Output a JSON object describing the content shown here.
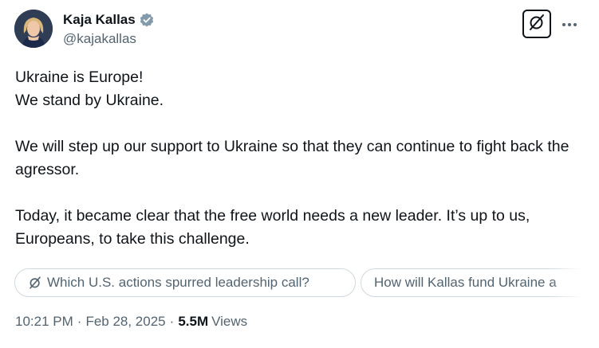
{
  "author": {
    "display_name": "Kaja Kallas",
    "handle": "@kajakallas",
    "verified": true
  },
  "tweet": {
    "lines": [
      "Ukraine is Europe!",
      "We stand by Ukraine.",
      "",
      "We will step up our support to Ukraine so that they can continue to fight back the agressor.",
      "",
      "Today, it became clear that the free world needs a new leader. It’s up to us, Europeans, to take this challenge."
    ]
  },
  "grok_suggestions": [
    {
      "label": "Which U.S. actions spurred leadership call?",
      "icon": "grok-icon"
    },
    {
      "label": "How will Kallas fund Ukraine a",
      "icon": "grok-icon"
    }
  ],
  "meta": {
    "time": "10:21 PM",
    "date": "Feb 28, 2025",
    "separator": "·",
    "views_count": "5.5M",
    "views_label": "Views"
  },
  "icons": {
    "verified": "verified-badge-icon",
    "grok": "grok-icon",
    "more": "more-dots-icon"
  },
  "colors": {
    "text_primary": "#0f1419",
    "text_secondary": "#536471",
    "verified_badge": "#829aab",
    "chip_border": "#cfd9de"
  }
}
